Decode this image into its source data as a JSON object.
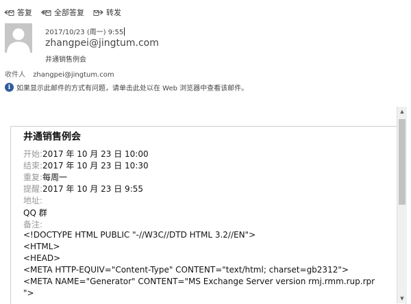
{
  "toolbar": {
    "reply": "答复",
    "reply_all": "全部答复",
    "forward": "转发"
  },
  "message": {
    "date": "2017/10/23 (周一) 9:55",
    "sender": "zhangpei@jingtum.com",
    "subject": "井通销售例会",
    "to_label": "收件人",
    "to_value": "zhangpei@jingtum.com",
    "info_notice": "如果显示此邮件的方式有问题，请单击此处以在 Web 浏览器中查看该邮件。"
  },
  "body": {
    "title": "井通销售例会",
    "start_label": "开始:",
    "start_value": "2017 年 10 月 23 日 10:00",
    "end_label": "结束:",
    "end_value": "2017 年 10 月 23 日 10:30",
    "repeat_label": "重复:",
    "repeat_value": "每周一",
    "remind_label": "提醒:",
    "remind_value": "2017 年 10 月 23 日 9:55",
    "location_label": "地址:",
    "location_value": "QQ 群",
    "notes_label": "备注:",
    "code_lines": [
      "<!DOCTYPE HTML PUBLIC \"-//W3C//DTD HTML 3.2//EN\">",
      "<HTML>",
      "<HEAD>",
      "<META HTTP-EQUIV=\"Content-Type\" CONTENT=\"text/html; charset=gb2312\">",
      "<META NAME=\"Generator\" CONTENT=\"MS Exchange Server version rmj.rmm.rup.rpr",
      "\">"
    ]
  },
  "colors": {
    "info_icon": "#2f5c9b",
    "avatar": "#c6c6c6"
  }
}
